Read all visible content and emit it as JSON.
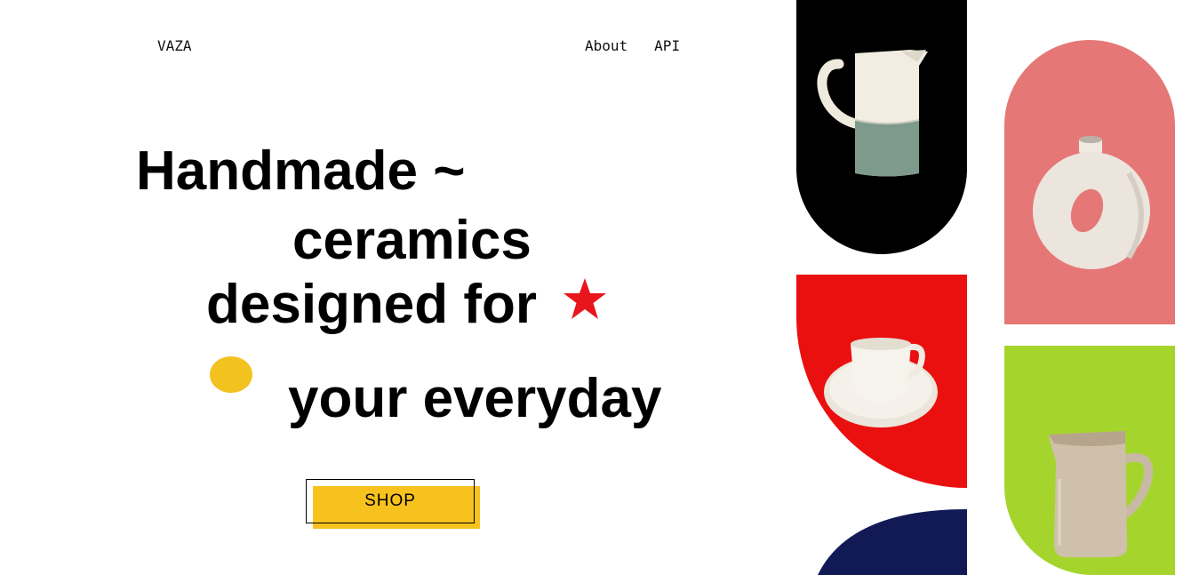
{
  "nav": {
    "brand": "VAZA",
    "links": [
      {
        "label": "About"
      },
      {
        "label": "API"
      }
    ]
  },
  "hero": {
    "line1": "Handmade ~",
    "line2": "ceramics",
    "line3": "designed for",
    "line4": "your everyday",
    "cta": "SHOP"
  },
  "decorations": {
    "star": {
      "icon": "star-icon",
      "color": "#e8161c"
    },
    "dot": {
      "icon": "dot-icon",
      "color": "#f2c21f"
    }
  },
  "gallery": [
    {
      "product": "two-tone-pitcher",
      "background": "#000000"
    },
    {
      "product": "donut-vase",
      "background": "#e57876"
    },
    {
      "product": "cup-and-saucer",
      "background": "#ea1010"
    },
    {
      "product": "beige-jug",
      "background": "#a5d52d"
    },
    {
      "product": "",
      "background": "#121a56"
    }
  ],
  "colors": {
    "cta_fill": "#f8c21e",
    "text": "#000000"
  }
}
